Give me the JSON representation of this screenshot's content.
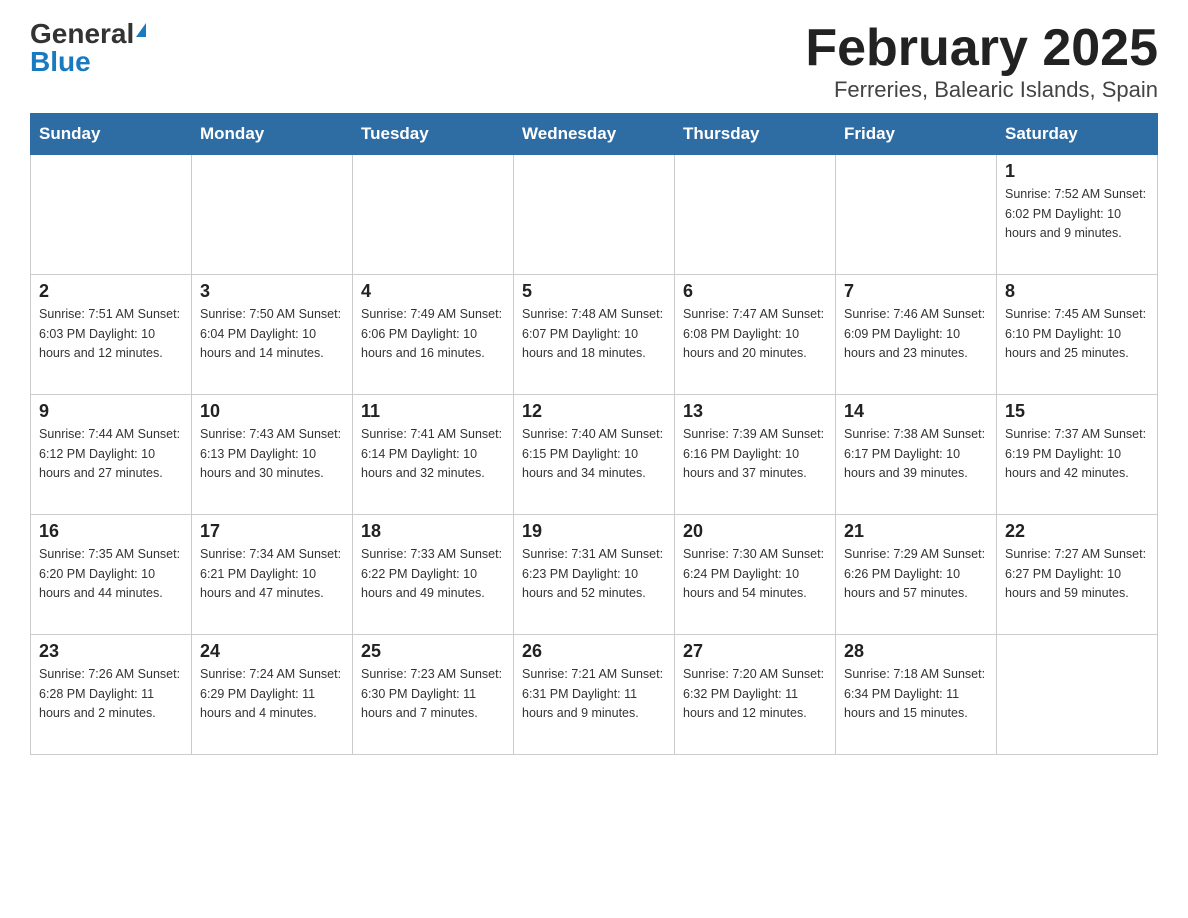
{
  "header": {
    "logo_general": "General",
    "logo_blue": "Blue",
    "title": "February 2025",
    "subtitle": "Ferreries, Balearic Islands, Spain"
  },
  "calendar": {
    "days_of_week": [
      "Sunday",
      "Monday",
      "Tuesday",
      "Wednesday",
      "Thursday",
      "Friday",
      "Saturday"
    ],
    "weeks": [
      [
        {
          "day": "",
          "info": ""
        },
        {
          "day": "",
          "info": ""
        },
        {
          "day": "",
          "info": ""
        },
        {
          "day": "",
          "info": ""
        },
        {
          "day": "",
          "info": ""
        },
        {
          "day": "",
          "info": ""
        },
        {
          "day": "1",
          "info": "Sunrise: 7:52 AM\nSunset: 6:02 PM\nDaylight: 10 hours and 9 minutes."
        }
      ],
      [
        {
          "day": "2",
          "info": "Sunrise: 7:51 AM\nSunset: 6:03 PM\nDaylight: 10 hours and 12 minutes."
        },
        {
          "day": "3",
          "info": "Sunrise: 7:50 AM\nSunset: 6:04 PM\nDaylight: 10 hours and 14 minutes."
        },
        {
          "day": "4",
          "info": "Sunrise: 7:49 AM\nSunset: 6:06 PM\nDaylight: 10 hours and 16 minutes."
        },
        {
          "day": "5",
          "info": "Sunrise: 7:48 AM\nSunset: 6:07 PM\nDaylight: 10 hours and 18 minutes."
        },
        {
          "day": "6",
          "info": "Sunrise: 7:47 AM\nSunset: 6:08 PM\nDaylight: 10 hours and 20 minutes."
        },
        {
          "day": "7",
          "info": "Sunrise: 7:46 AM\nSunset: 6:09 PM\nDaylight: 10 hours and 23 minutes."
        },
        {
          "day": "8",
          "info": "Sunrise: 7:45 AM\nSunset: 6:10 PM\nDaylight: 10 hours and 25 minutes."
        }
      ],
      [
        {
          "day": "9",
          "info": "Sunrise: 7:44 AM\nSunset: 6:12 PM\nDaylight: 10 hours and 27 minutes."
        },
        {
          "day": "10",
          "info": "Sunrise: 7:43 AM\nSunset: 6:13 PM\nDaylight: 10 hours and 30 minutes."
        },
        {
          "day": "11",
          "info": "Sunrise: 7:41 AM\nSunset: 6:14 PM\nDaylight: 10 hours and 32 minutes."
        },
        {
          "day": "12",
          "info": "Sunrise: 7:40 AM\nSunset: 6:15 PM\nDaylight: 10 hours and 34 minutes."
        },
        {
          "day": "13",
          "info": "Sunrise: 7:39 AM\nSunset: 6:16 PM\nDaylight: 10 hours and 37 minutes."
        },
        {
          "day": "14",
          "info": "Sunrise: 7:38 AM\nSunset: 6:17 PM\nDaylight: 10 hours and 39 minutes."
        },
        {
          "day": "15",
          "info": "Sunrise: 7:37 AM\nSunset: 6:19 PM\nDaylight: 10 hours and 42 minutes."
        }
      ],
      [
        {
          "day": "16",
          "info": "Sunrise: 7:35 AM\nSunset: 6:20 PM\nDaylight: 10 hours and 44 minutes."
        },
        {
          "day": "17",
          "info": "Sunrise: 7:34 AM\nSunset: 6:21 PM\nDaylight: 10 hours and 47 minutes."
        },
        {
          "day": "18",
          "info": "Sunrise: 7:33 AM\nSunset: 6:22 PM\nDaylight: 10 hours and 49 minutes."
        },
        {
          "day": "19",
          "info": "Sunrise: 7:31 AM\nSunset: 6:23 PM\nDaylight: 10 hours and 52 minutes."
        },
        {
          "day": "20",
          "info": "Sunrise: 7:30 AM\nSunset: 6:24 PM\nDaylight: 10 hours and 54 minutes."
        },
        {
          "day": "21",
          "info": "Sunrise: 7:29 AM\nSunset: 6:26 PM\nDaylight: 10 hours and 57 minutes."
        },
        {
          "day": "22",
          "info": "Sunrise: 7:27 AM\nSunset: 6:27 PM\nDaylight: 10 hours and 59 minutes."
        }
      ],
      [
        {
          "day": "23",
          "info": "Sunrise: 7:26 AM\nSunset: 6:28 PM\nDaylight: 11 hours and 2 minutes."
        },
        {
          "day": "24",
          "info": "Sunrise: 7:24 AM\nSunset: 6:29 PM\nDaylight: 11 hours and 4 minutes."
        },
        {
          "day": "25",
          "info": "Sunrise: 7:23 AM\nSunset: 6:30 PM\nDaylight: 11 hours and 7 minutes."
        },
        {
          "day": "26",
          "info": "Sunrise: 7:21 AM\nSunset: 6:31 PM\nDaylight: 11 hours and 9 minutes."
        },
        {
          "day": "27",
          "info": "Sunrise: 7:20 AM\nSunset: 6:32 PM\nDaylight: 11 hours and 12 minutes."
        },
        {
          "day": "28",
          "info": "Sunrise: 7:18 AM\nSunset: 6:34 PM\nDaylight: 11 hours and 15 minutes."
        },
        {
          "day": "",
          "info": ""
        }
      ]
    ]
  }
}
